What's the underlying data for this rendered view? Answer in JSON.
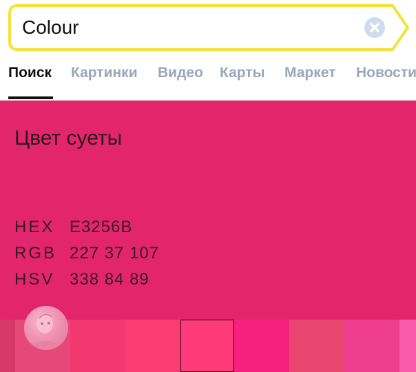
{
  "search": {
    "query": "Colour",
    "clear_icon": "close-circle-icon"
  },
  "tabs": [
    {
      "label": "Поиск",
      "active": true
    },
    {
      "label": "Картинки",
      "active": false
    },
    {
      "label": "Видео",
      "active": false
    },
    {
      "label": "Карты",
      "active": false
    },
    {
      "label": "Маркет",
      "active": false
    },
    {
      "label": "Новости",
      "active": false
    }
  ],
  "color_card": {
    "name": "Цвет суеты",
    "background": "#E3256B",
    "specs": [
      {
        "label": "HEX",
        "value": "E3256B"
      },
      {
        "label": "RGB",
        "value": "227 37 107"
      },
      {
        "label": "HSV",
        "value": "338 84 89"
      }
    ],
    "swatches": [
      "#d83a68",
      "#e6487a",
      "#f2386f",
      "#fa3c72",
      "#ff3a7a",
      "#f6207f",
      "#e8466e",
      "#ee3d8c",
      "#fa5cab"
    ],
    "selected_swatch": "#ff3a7a"
  },
  "accent_colors": {
    "search_border": "#fce340",
    "active_tab": "#111111",
    "inactive_tab": "#9aa7b8"
  }
}
